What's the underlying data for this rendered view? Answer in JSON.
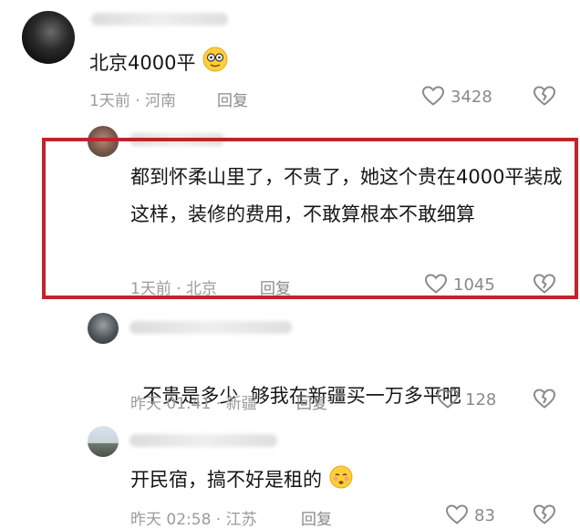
{
  "comments": [
    {
      "text": "北京4000平",
      "emoji": "face-emoji",
      "meta": "1天前 · 河南",
      "reply_label": "回复",
      "likes": "3428"
    },
    {
      "text": "都到怀柔山里了，不贵了，她这个贵在4000平装成这样，装修的费用，不敢算根本不敢细算",
      "meta": "1天前 · 北京",
      "reply_label": "回复",
      "likes": "1045",
      "highlight_color": "#c0242b"
    },
    {
      "text": "不贵是多少  够我在新疆买一万多平吧",
      "meta": "昨天 01:41 · 新疆",
      "reply_label": "回复",
      "likes": "128"
    },
    {
      "text": "开民宿，搞不好是租的",
      "emoji": "face-emoji",
      "meta": "昨天 02:58 · 江苏",
      "reply_label": "回复",
      "likes": "83"
    }
  ],
  "icons": {
    "like": "heart-outline-icon",
    "dislike": "broken-heart-icon"
  },
  "colors": {
    "highlight": "#c0242b",
    "meta": "#9b9b9b",
    "text": "#161616"
  }
}
